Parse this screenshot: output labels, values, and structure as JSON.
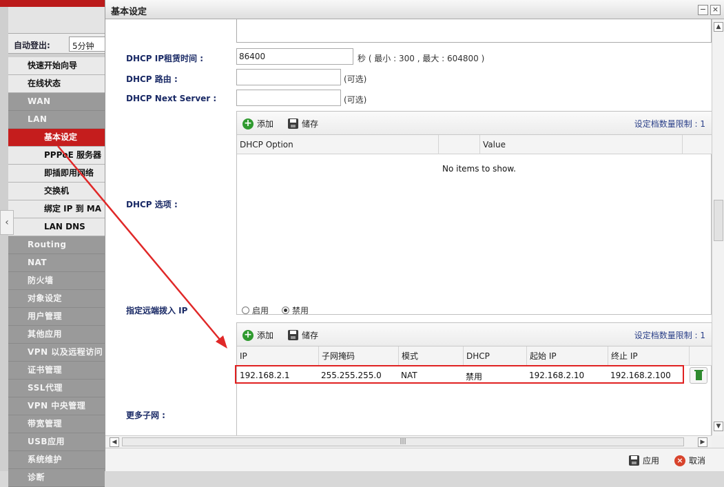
{
  "sidebar": {
    "auto_logout_label": "自动登出:",
    "auto_logout_value": "5分钟",
    "items": [
      {
        "label": "快速开始向导"
      },
      {
        "label": "在线状态"
      },
      {
        "label": "WAN"
      },
      {
        "label": "LAN"
      },
      {
        "label": "基本设定"
      },
      {
        "label": "PPPoE 服务器"
      },
      {
        "label": "即插即用网络"
      },
      {
        "label": "交换机"
      },
      {
        "label": "绑定 IP 到 MA"
      },
      {
        "label": "LAN DNS"
      },
      {
        "label": "Routing"
      },
      {
        "label": "NAT"
      },
      {
        "label": "防火墙"
      },
      {
        "label": "对象设定"
      },
      {
        "label": "用户管理"
      },
      {
        "label": "其他应用"
      },
      {
        "label": "VPN 以及远程访问"
      },
      {
        "label": "证书管理"
      },
      {
        "label": "SSL代理"
      },
      {
        "label": "VPN 中央管理"
      },
      {
        "label": "带宽管理"
      },
      {
        "label": "USB应用"
      },
      {
        "label": "系统维护"
      },
      {
        "label": "诊断"
      }
    ]
  },
  "dialog": {
    "title": "基本设定",
    "lease": {
      "label": "DHCP IP租赁时间 :",
      "value": "86400",
      "hint": "秒 ( 最小 : 300 , 最大 : 604800 )"
    },
    "route": {
      "label": "DHCP 路由 :",
      "value": "",
      "hint": "(可选)"
    },
    "next_server": {
      "label": "DHCP Next Server :",
      "value": "",
      "hint": "(可选)"
    },
    "dhcp_options": {
      "label": "DHCP 选项 :",
      "add": "添加",
      "save": "储存",
      "limit": "设定档数量限制 : 1",
      "columns": [
        "DHCP Option",
        "Value"
      ],
      "empty": "No items to show."
    },
    "remote_dialin": {
      "label": "指定远端拨入 IP",
      "enable": "启用",
      "disable": "禁用",
      "selected": "disable"
    },
    "more_subnets": {
      "label": "更多子网 :",
      "add": "添加",
      "save": "储存",
      "limit": "设定档数量限制 : 1",
      "columns": [
        "IP",
        "子网掩码",
        "模式",
        "DHCP",
        "起始 IP",
        "终止 IP"
      ],
      "rows": [
        {
          "ip": "192.168.2.1",
          "mask": "255.255.255.0",
          "mode": "NAT",
          "dhcp": "禁用",
          "start": "192.168.2.10",
          "end": "192.168.2.100"
        }
      ]
    },
    "footer": {
      "apply": "应用",
      "cancel": "取消"
    }
  }
}
